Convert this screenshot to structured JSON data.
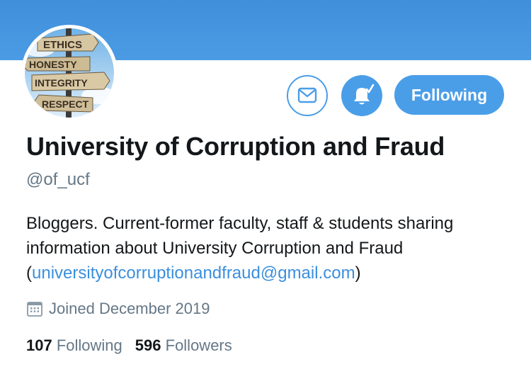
{
  "profile": {
    "display_name": "University of Corruption and Fraud",
    "handle": "@of_ucf",
    "bio_text": "Bloggers. Current-former faculty, staff & students sharing information about University Corruption and Fraud (",
    "bio_link": "universityofcorruptionandfraud@gmail.com",
    "bio_end": ")",
    "joined": "Joined December 2019",
    "avatar_signs": [
      "ETHICS",
      "HONESTY",
      "INTEGRITY",
      "RESPECT"
    ]
  },
  "actions": {
    "following_label": "Following",
    "message_icon": "envelope-icon",
    "notifications_icon": "bell-check-icon"
  },
  "stats": {
    "following_count": "107",
    "following_label": "Following",
    "followers_count": "596",
    "followers_label": "Followers"
  },
  "colors": {
    "banner": "#4b9be4",
    "accent": "#4a9ee8",
    "link": "#3b8fdd",
    "secondary_text": "#657786"
  }
}
